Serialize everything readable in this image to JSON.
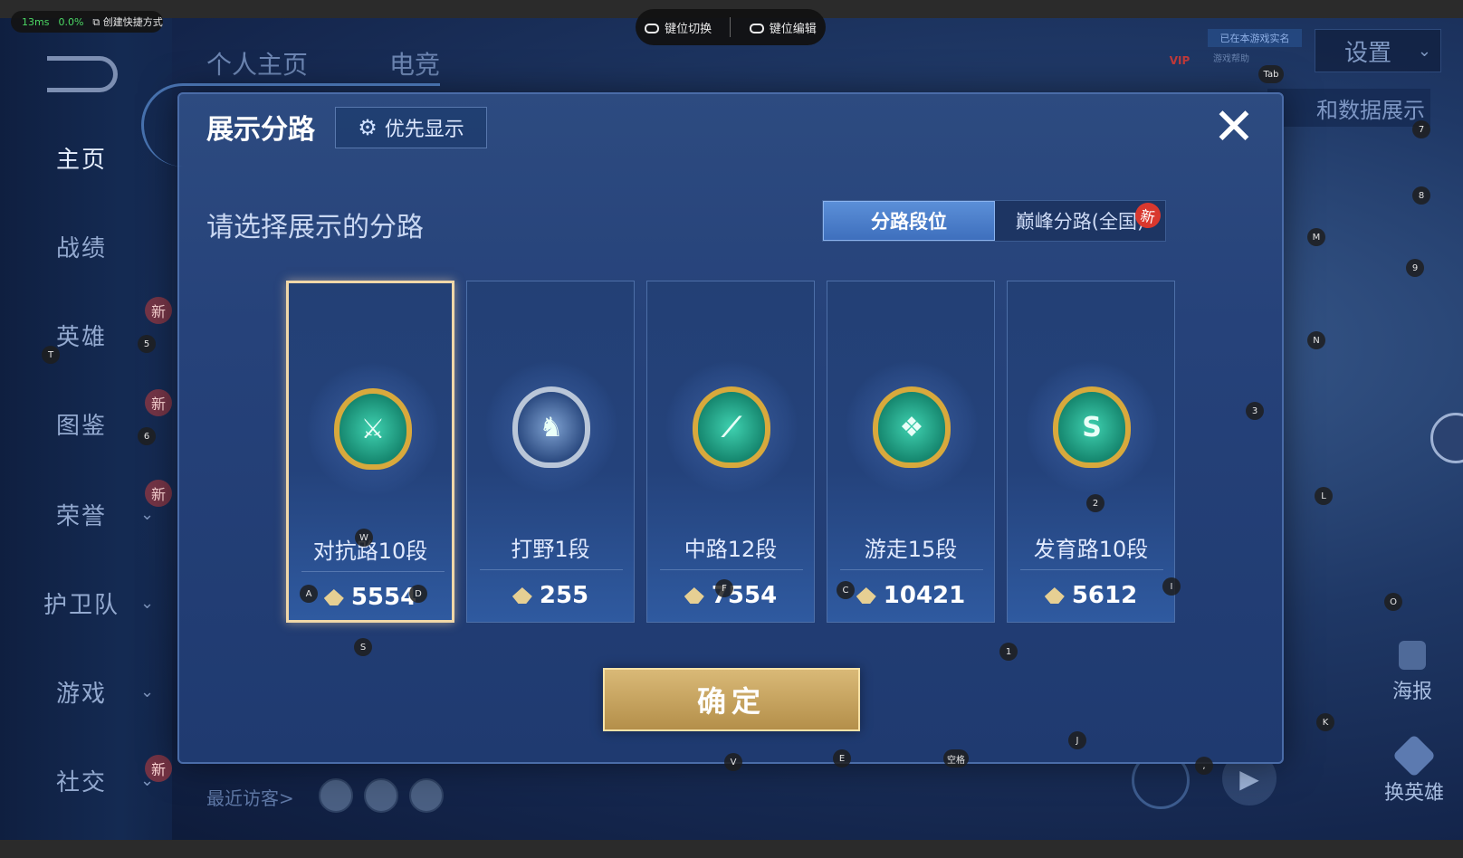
{
  "overlay": {
    "latency": "13ms",
    "loss": "0.0%",
    "shortcut_label": "创建快捷方式",
    "key_switch": "键位切换",
    "key_edit": "键位编辑"
  },
  "nav": {
    "items": [
      {
        "label": "主页",
        "has_new": false
      },
      {
        "label": "战绩",
        "has_new": false
      },
      {
        "label": "英雄",
        "has_new": true
      },
      {
        "label": "图鉴",
        "has_new": true
      },
      {
        "label": "荣誉",
        "has_new": true
      },
      {
        "label": "护卫队",
        "has_new": false
      },
      {
        "label": "游戏",
        "has_new": false
      },
      {
        "label": "社交",
        "has_new": true
      }
    ],
    "new_label": "新"
  },
  "background": {
    "tab_profile": "个人主页",
    "tab_esports": "电竞",
    "settings_label": "设置",
    "data_display_label": "和数据展示",
    "vip_label": "VIP",
    "status_tag": "已在本游戏实名",
    "status_sub": "游戏帮助",
    "poster_label": "海报",
    "swap_hero_label": "换英雄",
    "recent_visitors": "最近访客>"
  },
  "dialog": {
    "title": "展示分路",
    "priority_label": "优先显示",
    "close_label": "✕",
    "prompt": "请选择展示的分路",
    "tabs": {
      "active": "分路段位",
      "inactive": "巅峰分路(全国)",
      "new_tag": "新"
    },
    "lanes": [
      {
        "name": "对抗路10段",
        "points": "5554",
        "selected": true,
        "glyph": "⚔"
      },
      {
        "name": "打野1段",
        "points": "255",
        "selected": false,
        "glyph": "♞"
      },
      {
        "name": "中路12段",
        "points": "7554",
        "selected": false,
        "glyph": "⟋"
      },
      {
        "name": "游走15段",
        "points": "10421",
        "selected": false,
        "glyph": "❖"
      },
      {
        "name": "发育路10段",
        "points": "5612",
        "selected": false,
        "glyph": "S"
      }
    ],
    "confirm_label": "确定"
  },
  "keymap": [
    "Tab",
    "7",
    "8",
    "M",
    "9",
    "N",
    "3",
    "L",
    "2",
    "T",
    "5",
    "6",
    "W",
    "A",
    "D",
    "F",
    "C",
    "I",
    "S",
    "1",
    "O",
    "K",
    "J",
    "V",
    "E",
    "空格",
    ","
  ]
}
